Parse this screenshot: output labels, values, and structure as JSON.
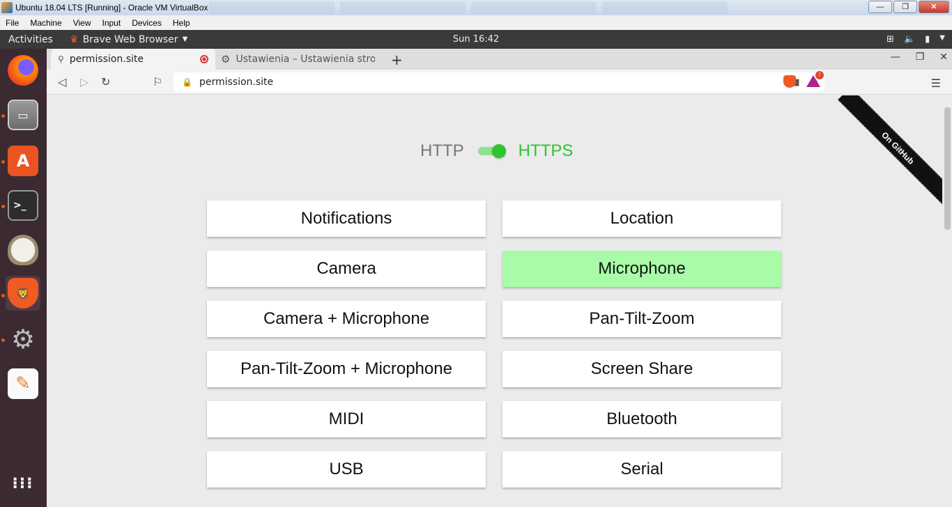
{
  "vbox": {
    "title": "Ubuntu 18.04 LTS [Running] - Oracle VM VirtualBox",
    "menu": [
      "File",
      "Machine",
      "View",
      "Input",
      "Devices",
      "Help"
    ]
  },
  "ubuntu": {
    "activities": "Activities",
    "app_name": "Brave Web Browser",
    "clock": "Sun 16:42"
  },
  "dock": {
    "items": [
      "firefox",
      "files",
      "software-center",
      "terminal",
      "gimp",
      "brave",
      "settings",
      "text-editor",
      "show-applications"
    ]
  },
  "browser": {
    "tabs": [
      {
        "label": "permission.site",
        "recording": true
      },
      {
        "label": "Ustawienia – Ustawienia stron"
      }
    ],
    "url": "permission.site"
  },
  "page": {
    "protocol_left": "HTTP",
    "protocol_right": "HTTPS",
    "https_enabled": true,
    "ribbon": "On GitHub",
    "buttons": [
      {
        "label": "Notifications",
        "granted": false
      },
      {
        "label": "Location",
        "granted": false
      },
      {
        "label": "Camera",
        "granted": false
      },
      {
        "label": "Microphone",
        "granted": true
      },
      {
        "label": "Camera + Microphone",
        "granted": false
      },
      {
        "label": "Pan-Tilt-Zoom",
        "granted": false
      },
      {
        "label": "Pan-Tilt-Zoom + Microphone",
        "granted": false
      },
      {
        "label": "Screen Share",
        "granted": false
      },
      {
        "label": "MIDI",
        "granted": false
      },
      {
        "label": "Bluetooth",
        "granted": false
      },
      {
        "label": "USB",
        "granted": false
      },
      {
        "label": "Serial",
        "granted": false
      }
    ],
    "granted_color": "#a8fca8",
    "https_color": "#2ec52e"
  }
}
